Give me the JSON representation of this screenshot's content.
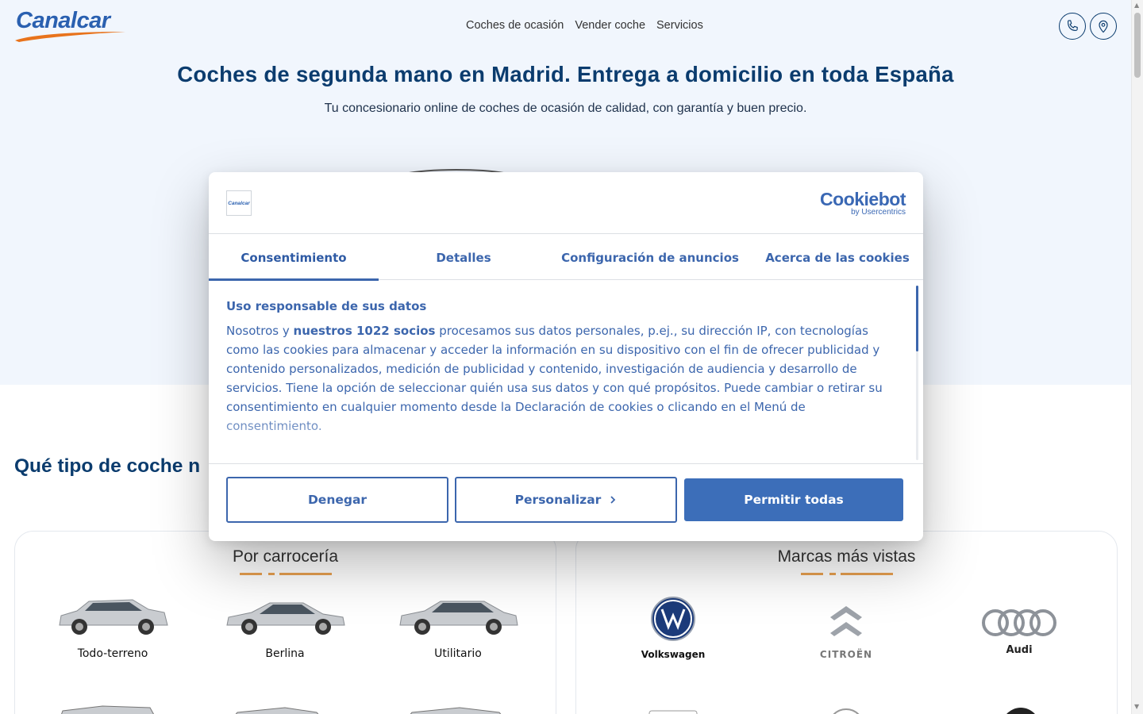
{
  "header": {
    "logo_text": "Canalcar",
    "nav": [
      "Coches de ocasión",
      "Vender coche",
      "Servicios"
    ],
    "icons": [
      "phone-icon",
      "location-pin-icon"
    ]
  },
  "hero": {
    "title": "Coches de segunda mano en Madrid. Entrega a domicilio en toda España",
    "subtitle": "Tu concesionario online de coches de ocasión de calidad, con garantía y buen precio."
  },
  "section": {
    "title": "Qué tipo de coche n"
  },
  "body_card": {
    "title": "Por carrocería",
    "items": [
      "Todo-terreno",
      "Berlina",
      "Utilitario"
    ]
  },
  "brands_card": {
    "title": "Marcas más vistas",
    "items": [
      "Volkswagen",
      "CITROËN",
      "Audi"
    ]
  },
  "cookie_dialog": {
    "logo_text": "Canalcar",
    "provider_name": "Cookiebot",
    "provider_by": "by Usercentrics",
    "tabs": [
      "Consentimiento",
      "Detalles",
      "Configuración de anuncios",
      "Acerca de las cookies"
    ],
    "active_tab": "Consentimiento",
    "body_title": "Uso responsable de sus datos",
    "body_prefix": "Nosotros y ",
    "body_bold": "nuestros 1022 socios",
    "body_rest": " procesamos sus datos personales, p.ej., su dirección IP, con tecnologías como las cookies para almacenar y acceder la información en su dispositivo con el fin de ofrecer publicidad y contenido personalizados, medición de publicidad y contenido, investigación de audiencia y desarrollo de servicios. Tiene la opción de seleccionar quién usa sus datos y con qué propósitos. Puede cambiar o retirar su consentimiento en cualquier momento desde la Declaración de cookies o clicando en el Menú de consentimiento.",
    "buttons": {
      "deny": "Denegar",
      "customize": "Personalizar",
      "allow_all": "Permitir todas"
    }
  },
  "colors": {
    "brand_blue": "#0b3c6e",
    "cookiebot_blue": "#3c66ad",
    "accent_orange": "#e8731c",
    "hero_bg": "#f1f6fd"
  }
}
